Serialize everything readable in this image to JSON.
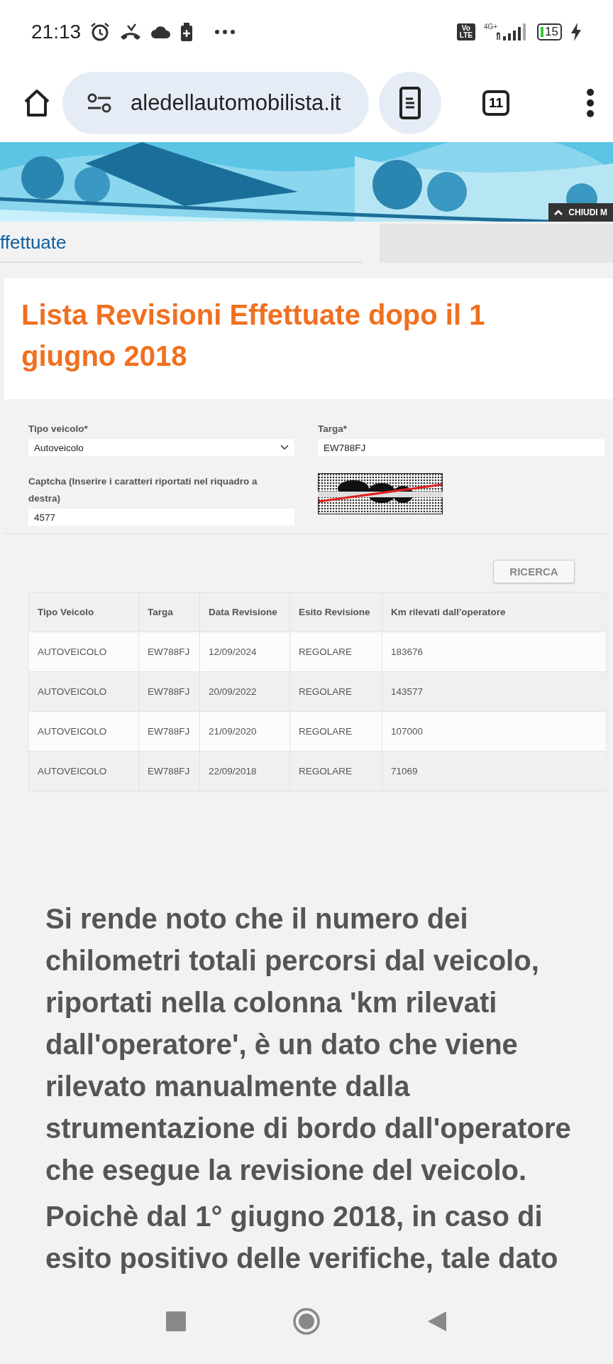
{
  "status_bar": {
    "time": "21:13",
    "network_badge": "Vo LTE",
    "network_type": "4G+",
    "battery": "15",
    "charging": true
  },
  "browser": {
    "url": "aledellautomobilista.it",
    "tab_count": "11"
  },
  "banner": {
    "close_label": "CHIUDI M"
  },
  "section_title": "ffettuate",
  "title": "Lista Revisioni Effettuate dopo il 1 giugno 2018",
  "form": {
    "fields": [
      {
        "label": "Tipo veicolo*",
        "kind": "select",
        "value": "Autoveicolo"
      },
      {
        "label": "Targa*",
        "kind": "text",
        "value": "EW788FJ"
      },
      {
        "label": "Captcha (Inserire i caratteri riportati nel riquadro a destra)",
        "kind": "text",
        "value": "4577"
      }
    ]
  },
  "search_button": "RICERCA",
  "table": {
    "columns": [
      "Tipo Veicolo",
      "Targa",
      "Data Revisione",
      "Esito Revisione",
      "Km rilevati dall'operatore"
    ],
    "rows": [
      [
        "AUTOVEICOLO",
        "EW788FJ",
        "12/09/2024",
        "REGOLARE",
        "183676"
      ],
      [
        "AUTOVEICOLO",
        "EW788FJ",
        "20/09/2022",
        "REGOLARE",
        "143577"
      ],
      [
        "AUTOVEICOLO",
        "EW788FJ",
        "21/09/2020",
        "REGOLARE",
        "107000"
      ],
      [
        "AUTOVEICOLO",
        "EW788FJ",
        "22/09/2018",
        "REGOLARE",
        "71069"
      ]
    ]
  },
  "notice": [
    "Si rende noto che il numero dei chilometri totali percorsi dal veicolo, riportati nella colonna 'km rilevati dall'operatore', è un dato che viene rilevato manualmente dalla strumentazione di bordo dall'operatore che esegue la revisione del veicolo.",
    "Poichè dal 1° giugno 2018, in caso di esito positivo delle verifiche, tale dato"
  ]
}
